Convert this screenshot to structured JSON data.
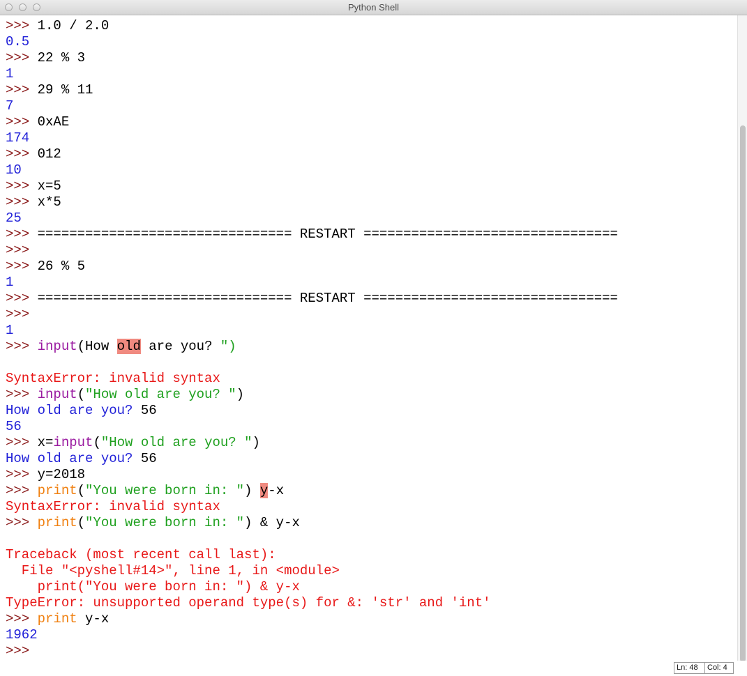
{
  "window": {
    "title": "Python Shell"
  },
  "shell": {
    "lines": [
      [
        {
          "c": "p",
          "t": ">>> "
        },
        {
          "c": "",
          "t": "1.0 / 2.0"
        }
      ],
      [
        {
          "c": "o",
          "t": "0.5"
        }
      ],
      [
        {
          "c": "p",
          "t": ">>> "
        },
        {
          "c": "",
          "t": "22 % 3"
        }
      ],
      [
        {
          "c": "o",
          "t": "1"
        }
      ],
      [
        {
          "c": "p",
          "t": ">>> "
        },
        {
          "c": "",
          "t": "29 % 11"
        }
      ],
      [
        {
          "c": "o",
          "t": "7"
        }
      ],
      [
        {
          "c": "p",
          "t": ">>> "
        },
        {
          "c": "",
          "t": "0xAE"
        }
      ],
      [
        {
          "c": "o",
          "t": "174"
        }
      ],
      [
        {
          "c": "p",
          "t": ">>> "
        },
        {
          "c": "",
          "t": "012"
        }
      ],
      [
        {
          "c": "o",
          "t": "10"
        }
      ],
      [
        {
          "c": "p",
          "t": ">>> "
        },
        {
          "c": "",
          "t": "x=5"
        }
      ],
      [
        {
          "c": "p",
          "t": ">>> "
        },
        {
          "c": "",
          "t": "x*5"
        }
      ],
      [
        {
          "c": "o",
          "t": "25"
        }
      ],
      [
        {
          "c": "p",
          "t": ">>> "
        },
        {
          "c": "",
          "t": "================================ RESTART ================================"
        }
      ],
      [
        {
          "c": "p",
          "t": ">>>"
        }
      ],
      [
        {
          "c": "p",
          "t": ">>> "
        },
        {
          "c": "",
          "t": "26 % 5"
        }
      ],
      [
        {
          "c": "o",
          "t": "1"
        }
      ],
      [
        {
          "c": "p",
          "t": ">>> "
        },
        {
          "c": "",
          "t": "================================ RESTART ================================"
        }
      ],
      [
        {
          "c": "p",
          "t": ">>>"
        }
      ],
      [
        {
          "c": "o",
          "t": "1"
        }
      ],
      [
        {
          "c": "p",
          "t": ">>> "
        },
        {
          "c": "k",
          "t": "input"
        },
        {
          "c": "",
          "t": "(How "
        },
        {
          "c": "hl",
          "t": "old"
        },
        {
          "c": "",
          "t": " are you? "
        },
        {
          "c": "s",
          "t": "\")"
        }
      ],
      [
        {
          "c": "",
          "t": ""
        }
      ],
      [
        {
          "c": "e",
          "t": "SyntaxError: invalid syntax"
        }
      ],
      [
        {
          "c": "p",
          "t": ">>> "
        },
        {
          "c": "k",
          "t": "input"
        },
        {
          "c": "",
          "t": "("
        },
        {
          "c": "s",
          "t": "\"How old are you? \""
        },
        {
          "c": "",
          "t": ")"
        }
      ],
      [
        {
          "c": "o",
          "t": "How old are you? "
        },
        {
          "c": "",
          "t": "56"
        }
      ],
      [
        {
          "c": "o",
          "t": "56"
        }
      ],
      [
        {
          "c": "p",
          "t": ">>> "
        },
        {
          "c": "",
          "t": "x="
        },
        {
          "c": "k",
          "t": "input"
        },
        {
          "c": "",
          "t": "("
        },
        {
          "c": "s",
          "t": "\"How old are you? \""
        },
        {
          "c": "",
          "t": ")"
        }
      ],
      [
        {
          "c": "o",
          "t": "How old are you? "
        },
        {
          "c": "",
          "t": "56"
        }
      ],
      [
        {
          "c": "p",
          "t": ">>> "
        },
        {
          "c": "",
          "t": "y=2018"
        }
      ],
      [
        {
          "c": "p",
          "t": ">>> "
        },
        {
          "c": "kw",
          "t": "print"
        },
        {
          "c": "",
          "t": "("
        },
        {
          "c": "s",
          "t": "\"You were born in: \""
        },
        {
          "c": "",
          "t": ") "
        },
        {
          "c": "hl",
          "t": "y"
        },
        {
          "c": "",
          "t": "-x"
        }
      ],
      [
        {
          "c": "e",
          "t": "SyntaxError: invalid syntax"
        }
      ],
      [
        {
          "c": "p",
          "t": ">>> "
        },
        {
          "c": "kw",
          "t": "print"
        },
        {
          "c": "",
          "t": "("
        },
        {
          "c": "s",
          "t": "\"You were born in: \""
        },
        {
          "c": "",
          "t": ") & y-x"
        }
      ],
      [
        {
          "c": "",
          "t": ""
        }
      ],
      [
        {
          "c": "e",
          "t": "Traceback (most recent call last):"
        }
      ],
      [
        {
          "c": "e",
          "t": "  File \"<pyshell#14>\", line 1, in <module>"
        }
      ],
      [
        {
          "c": "e",
          "t": "    print(\"You were born in: \") & y-x"
        }
      ],
      [
        {
          "c": "e",
          "t": "TypeError: unsupported operand type(s) for &: 'str' and 'int'"
        }
      ],
      [
        {
          "c": "p",
          "t": ">>> "
        },
        {
          "c": "kw",
          "t": "print"
        },
        {
          "c": "",
          "t": " y-x"
        }
      ],
      [
        {
          "c": "o",
          "t": "1962"
        }
      ],
      [
        {
          "c": "p",
          "t": ">>> "
        }
      ]
    ]
  },
  "statusbar": {
    "line": "Ln: 48",
    "col": "Col: 4"
  }
}
